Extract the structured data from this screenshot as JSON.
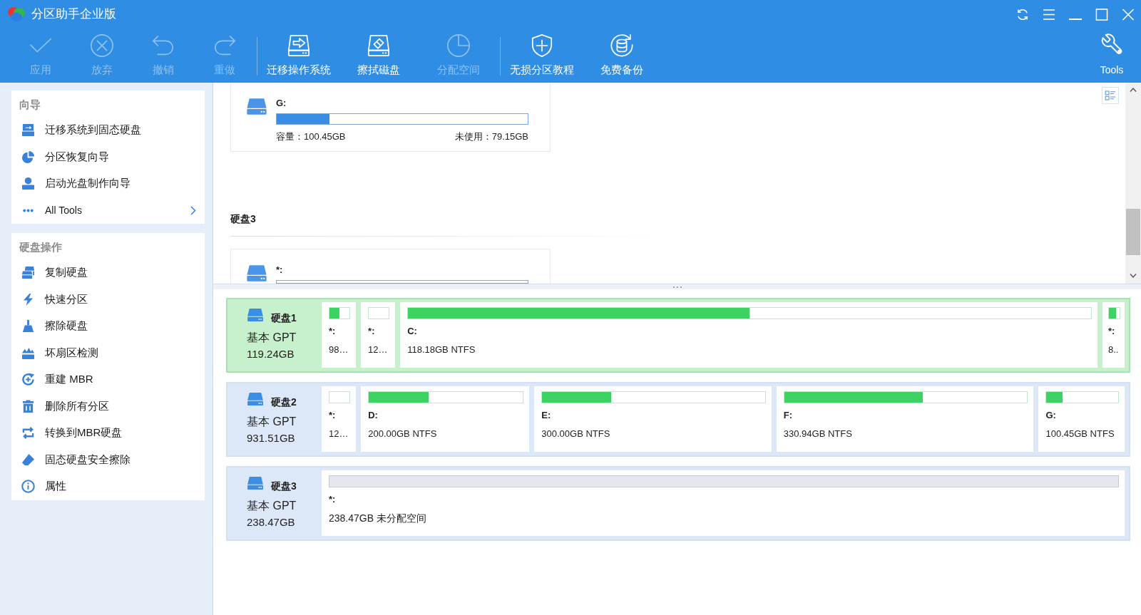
{
  "window": {
    "title": "分区助手企业版"
  },
  "toolbar": {
    "groups": [
      [
        {
          "label": "应用",
          "disabled": true
        },
        {
          "label": "放弃",
          "disabled": true
        },
        {
          "label": "撤销",
          "disabled": true
        },
        {
          "label": "重做",
          "disabled": true
        }
      ],
      [
        {
          "label": "迁移操作系统",
          "disabled": false
        },
        {
          "label": "擦拭磁盘",
          "disabled": false
        },
        {
          "label": "分配空间",
          "disabled": true
        }
      ],
      [
        {
          "label": "无损分区教程",
          "disabled": false
        },
        {
          "label": "免费备份",
          "disabled": false
        }
      ]
    ],
    "tools": {
      "label": "Tools"
    }
  },
  "sidebar": {
    "sections": [
      {
        "title": "向导",
        "items": [
          {
            "kind": "action",
            "label": "迁移系统到固态硬盘"
          },
          {
            "kind": "action",
            "label": "分区恢复向导"
          },
          {
            "kind": "action",
            "label": "启动光盘制作向导"
          },
          {
            "kind": "more",
            "label": "All Tools"
          }
        ]
      },
      {
        "title": "硬盘操作",
        "items": [
          {
            "kind": "action",
            "label": "复制硬盘"
          },
          {
            "kind": "action",
            "label": "快速分区"
          },
          {
            "kind": "action",
            "label": "擦除硬盘"
          },
          {
            "kind": "action",
            "label": "坏扇区检测"
          },
          {
            "kind": "action",
            "label": "重建 MBR"
          },
          {
            "kind": "action",
            "label": "删除所有分区"
          },
          {
            "kind": "action",
            "label": "转换到MBR硬盘"
          },
          {
            "kind": "action",
            "label": "固态硬盘安全擦除"
          },
          {
            "kind": "action",
            "label": "属性"
          }
        ]
      }
    ]
  },
  "partition_list": {
    "items": [
      {
        "kind": "partition",
        "drive": "G:",
        "level": 0.21,
        "capacity": "容量：100.45GB",
        "unused": "未使用：79.15GB"
      },
      {
        "kind": "heading",
        "title": "硬盘3"
      },
      {
        "kind": "partition",
        "drive": "*:"
      }
    ]
  },
  "disk_map": {
    "disks": [
      {
        "name": "硬盘1",
        "type": "基本 GPT",
        "size": "119.24GB",
        "selected": true,
        "partitions": [
          {
            "kind": "partition",
            "drive": "*:",
            "info": "98…",
            "level": 0.5
          },
          {
            "kind": "partition",
            "drive": "*:",
            "info": "12…"
          },
          {
            "kind": "partition",
            "drive": "C:",
            "info": "118.18GB NTFS",
            "level": 0.5
          },
          {
            "kind": "partition",
            "drive": "*:",
            "info": "8..",
            "level": 0.7
          }
        ]
      },
      {
        "name": "硬盘2",
        "type": "基本 GPT",
        "size": "931.51GB",
        "selected": false,
        "partitions": [
          {
            "kind": "partition",
            "drive": "*:",
            "info": "12…"
          },
          {
            "kind": "partition",
            "drive": "D:",
            "info": "200.00GB NTFS",
            "level": 0.39
          },
          {
            "kind": "partition",
            "drive": "E:",
            "info": "300.00GB NTFS",
            "level": 0.31
          },
          {
            "kind": "partition",
            "drive": "F:",
            "info": "330.94GB NTFS",
            "level": 0.57
          },
          {
            "kind": "partition",
            "drive": "G:",
            "info": "100.45GB NTFS",
            "level": 0.22
          }
        ]
      },
      {
        "name": "硬盘3",
        "type": "基本 GPT",
        "size": "238.47GB",
        "selected": false,
        "partitions": [
          {
            "kind": "unallocated",
            "drive": "*:",
            "info": "238.47GB 未分配空间"
          }
        ]
      }
    ]
  }
}
